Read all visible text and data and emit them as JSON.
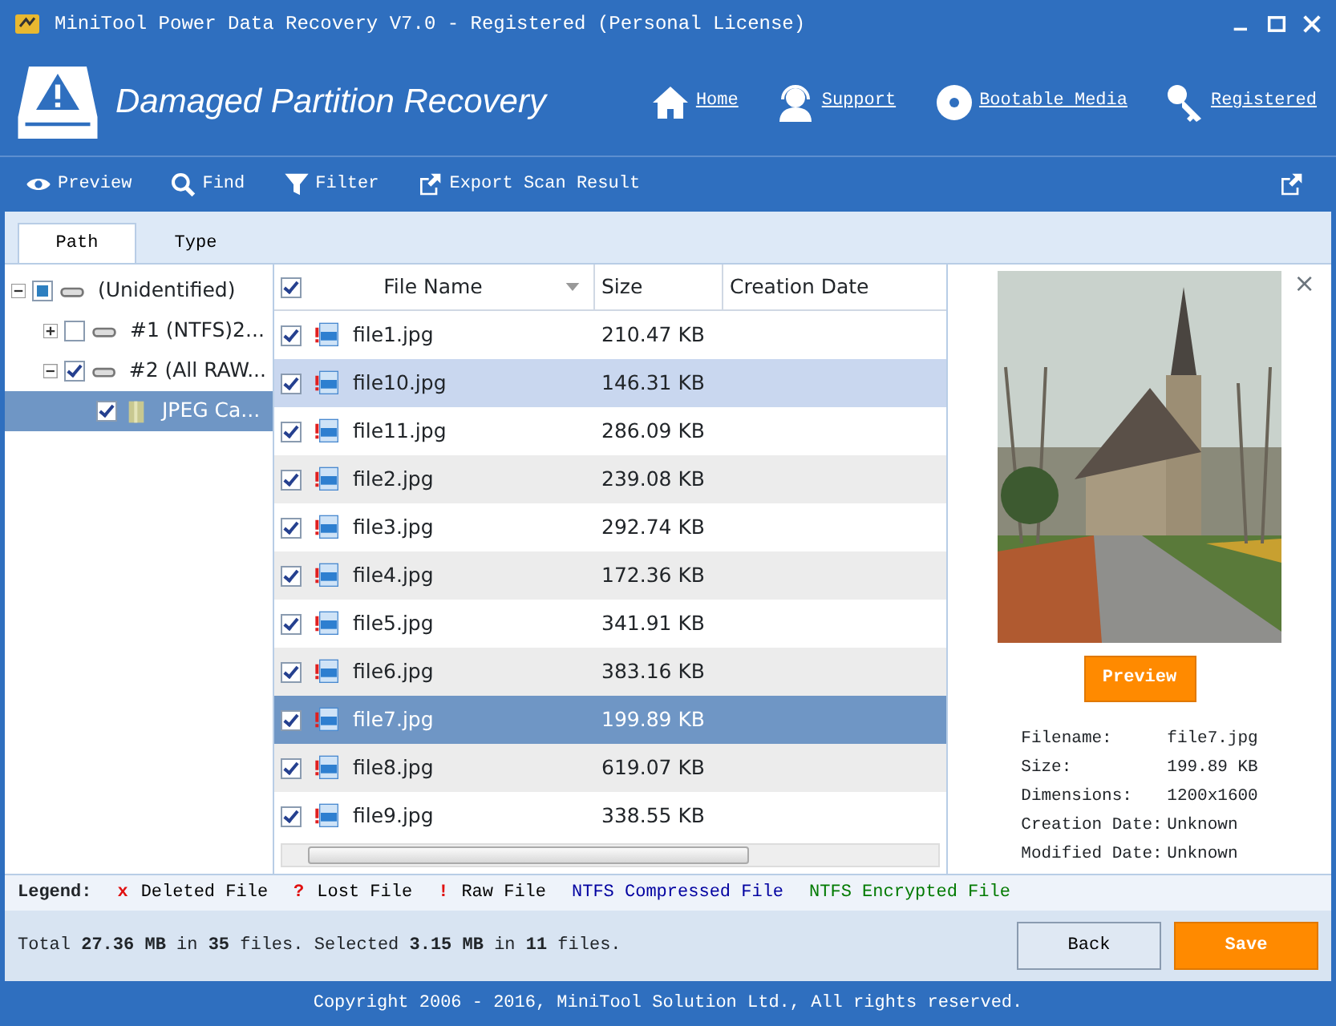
{
  "window": {
    "title": "MiniTool Power Data Recovery V7.0 - Registered (Personal License)"
  },
  "header": {
    "title": "Damaged Partition Recovery",
    "links": [
      {
        "kind": "home",
        "label": "Home"
      },
      {
        "kind": "support",
        "label": "Support"
      },
      {
        "kind": "media",
        "label": "Bootable Media"
      },
      {
        "kind": "key",
        "label": "Registered"
      }
    ]
  },
  "toolbar": [
    {
      "kind": "eye",
      "label": "Preview"
    },
    {
      "kind": "search",
      "label": "Find"
    },
    {
      "kind": "filter",
      "label": "Filter"
    },
    {
      "kind": "export",
      "label": "Export Scan Result"
    }
  ],
  "tabs": [
    {
      "label": "Path",
      "selected": true
    },
    {
      "label": "Type",
      "selected": false
    }
  ],
  "tree": [
    {
      "label": "(Unidentified)",
      "checked": false,
      "partial": true,
      "expanded": true,
      "kind": "drive",
      "children": [
        {
          "label": "#1 (NTFS)2...",
          "checked": false,
          "expanded": false,
          "kind": "drive",
          "selected": false
        },
        {
          "label": "#2 (All RAW...",
          "checked": true,
          "expanded": true,
          "kind": "drive",
          "selected": false,
          "children": [
            {
              "label": "JPEG Ca...",
              "checked": true,
              "kind": "folder",
              "selected": true
            }
          ]
        }
      ]
    }
  ],
  "table": {
    "columns": [
      "File Name",
      "Size",
      "Creation Date"
    ],
    "header_checked": true,
    "rows": [
      {
        "name": "file1.jpg",
        "size": "210.47 KB",
        "checked": true,
        "selected": false,
        "hovered": false
      },
      {
        "name": "file10.jpg",
        "size": "146.31 KB",
        "checked": true,
        "selected": false,
        "hovered": true
      },
      {
        "name": "file11.jpg",
        "size": "286.09 KB",
        "checked": true,
        "selected": false,
        "hovered": false
      },
      {
        "name": "file2.jpg",
        "size": "239.08 KB",
        "checked": true,
        "selected": false,
        "hovered": false
      },
      {
        "name": "file3.jpg",
        "size": "292.74 KB",
        "checked": true,
        "selected": false,
        "hovered": false
      },
      {
        "name": "file4.jpg",
        "size": "172.36 KB",
        "checked": true,
        "selected": false,
        "hovered": false
      },
      {
        "name": "file5.jpg",
        "size": "341.91 KB",
        "checked": true,
        "selected": false,
        "hovered": false
      },
      {
        "name": "file6.jpg",
        "size": "383.16 KB",
        "checked": true,
        "selected": false,
        "hovered": false
      },
      {
        "name": "file7.jpg",
        "size": "199.89 KB",
        "checked": true,
        "selected": true,
        "hovered": false
      },
      {
        "name": "file8.jpg",
        "size": "619.07 KB",
        "checked": true,
        "selected": false,
        "hovered": false
      },
      {
        "name": "file9.jpg",
        "size": "338.55 KB",
        "checked": true,
        "selected": false,
        "hovered": false
      }
    ]
  },
  "preview": {
    "close": "×",
    "button": "Preview",
    "info": [
      {
        "label": "Filename:",
        "value": "file7.jpg"
      },
      {
        "label": "Size:",
        "value": "199.89 KB"
      },
      {
        "label": "Dimensions:",
        "value": "1200x1600"
      },
      {
        "label": "Creation Date:",
        "value": "Unknown"
      },
      {
        "label": "Modified Date:",
        "value": "Unknown"
      }
    ]
  },
  "legend": {
    "title": "Legend:",
    "items": [
      {
        "symbol": "x",
        "label": "Deleted File",
        "color": "#000000"
      },
      {
        "symbol": "?",
        "label": "Lost File",
        "color": "#000000"
      },
      {
        "symbol": "!",
        "label": "Raw File",
        "color": "#000000"
      },
      {
        "label": "NTFS Compressed File",
        "color": "#0000a0"
      },
      {
        "label": "NTFS Encrypted File",
        "color": "#007a00"
      }
    ]
  },
  "status": "Total **27.36 MB** in **35** files. Selected **3.15 MB** in **11** files.",
  "buttons": [
    {
      "label": "Back",
      "kind": "secondary"
    },
    {
      "label": "Save",
      "kind": "primary"
    }
  ],
  "footer": "Copyright 2006 - 2016, MiniTool Solution Ltd., All rights reserved."
}
